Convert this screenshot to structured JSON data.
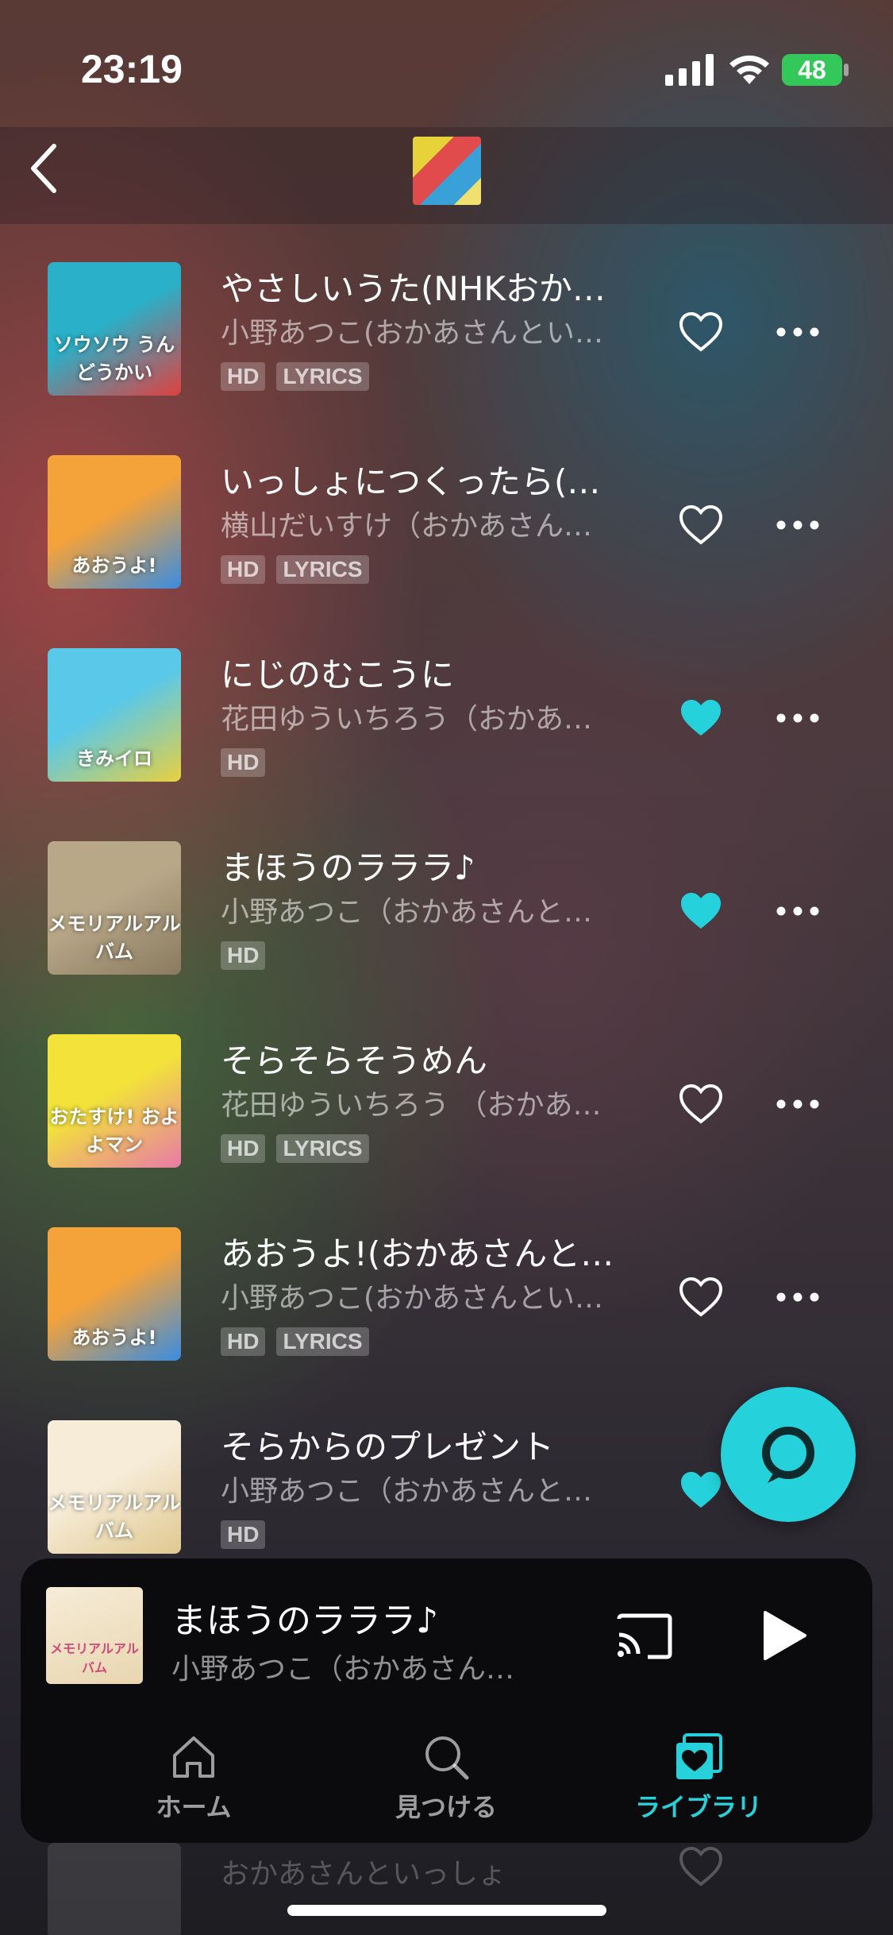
{
  "status_bar": {
    "time": "23:19",
    "battery": "48"
  },
  "header": {
    "back_icon": "chevron-left-icon",
    "album_art_icon": "album-collage-art"
  },
  "tracks": [
    {
      "title": "やさしいうた(NHKおか…",
      "artist": "小野あつこ(おかあさんとい…",
      "badges": [
        "HD",
        "LYRICS"
      ],
      "liked": false,
      "art_label": "ソウソウ うんどうかい",
      "art_colors": [
        "#2ab0c8",
        "#e04040"
      ]
    },
    {
      "title": "いっしょにつくったら(…",
      "artist": "横山だいすけ（おかあさん…",
      "badges": [
        "HD",
        "LYRICS"
      ],
      "liked": false,
      "art_label": "あおうよ!",
      "art_colors": [
        "#f4a23a",
        "#3a8de0"
      ]
    },
    {
      "title": "にじのむこうに",
      "artist": "花田ゆういちろう（おかあ…",
      "badges": [
        "HD"
      ],
      "liked": true,
      "art_label": "きみイロ",
      "art_colors": [
        "#5ac8e8",
        "#e8d040"
      ]
    },
    {
      "title": "まほうのラララ♪",
      "artist": "小野あつこ（おかあさんと…",
      "badges": [
        "HD"
      ],
      "liked": true,
      "art_label": "メモリアルアルバム",
      "art_colors": [
        "#b8a888",
        "#8a7a60"
      ]
    },
    {
      "title": "そらそらそうめん",
      "artist": "花田ゆういちろう （おかあ…",
      "badges": [
        "HD",
        "LYRICS"
      ],
      "liked": false,
      "art_label": "おたすけ! およよマン",
      "art_colors": [
        "#f2e23a",
        "#e87aa8"
      ]
    },
    {
      "title": "あおうよ!(おかあさんと…",
      "artist": "小野あつこ(おかあさんとい…",
      "badges": [
        "HD",
        "LYRICS"
      ],
      "liked": false,
      "art_label": "あおうよ!",
      "art_colors": [
        "#f4a23a",
        "#3a8de0"
      ]
    },
    {
      "title": "そらからのプレゼント",
      "artist": "小野あつこ（おかあさんと…",
      "badges": [
        "HD"
      ],
      "liked": true,
      "art_label": "メモリアルアルバム",
      "art_colors": [
        "#f6ecd8",
        "#e0c890"
      ]
    }
  ],
  "partial_row": {
    "artist": "おかあさんといっしょ"
  },
  "now_playing": {
    "title": "まほうのラララ♪",
    "artist": "小野あつこ（おかあさん…",
    "art_label": "メモリアルアルバム"
  },
  "tabs": [
    {
      "label": "ホーム",
      "icon": "home-icon",
      "active": false
    },
    {
      "label": "見つける",
      "icon": "search-icon",
      "active": false
    },
    {
      "label": "ライブラリ",
      "icon": "library-heart-icon",
      "active": true
    }
  ],
  "colors": {
    "accent": "#25d1da",
    "battery": "#34c759"
  }
}
